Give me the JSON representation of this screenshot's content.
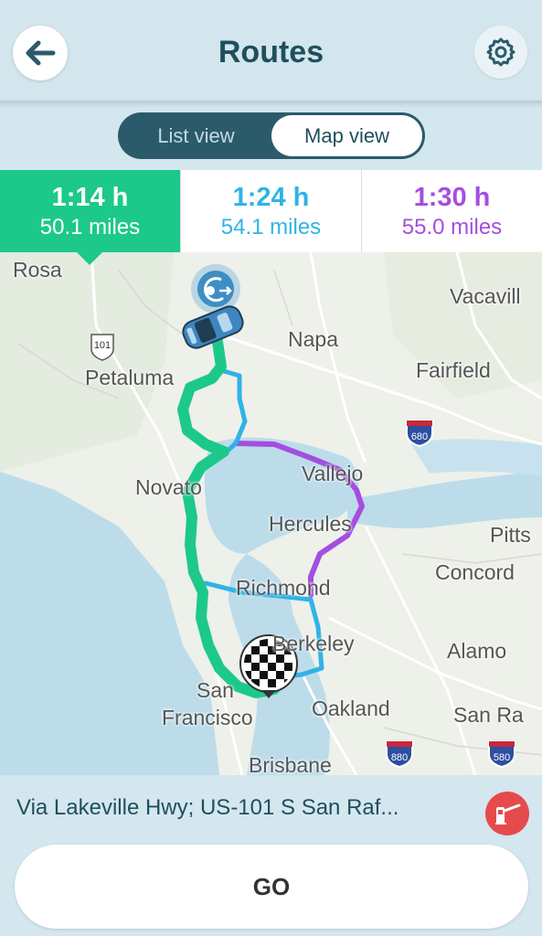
{
  "header": {
    "title": "Routes",
    "back_icon": "arrow-left-icon",
    "settings_icon": "gear-icon"
  },
  "view_toggle": {
    "list_label": "List view",
    "map_label": "Map view",
    "selected": "Map view"
  },
  "routes": [
    {
      "time": "1:14 h",
      "distance": "50.1 miles",
      "color": "#1cc98a",
      "selected": true
    },
    {
      "time": "1:24 h",
      "distance": "54.1 miles",
      "color": "#2fb3e6",
      "selected": false
    },
    {
      "time": "1:30 h",
      "distance": "55.0 miles",
      "color": "#a44ee0",
      "selected": false
    }
  ],
  "map": {
    "places": [
      "Rosa",
      "Vacavill",
      "Napa",
      "Petaluma",
      "Fairfield",
      "Novato",
      "Vallejo",
      "Hercules",
      "Pitts",
      "Concord",
      "Richmond",
      "Berkeley",
      "Alamo",
      "San",
      "Francisco",
      "Oakland",
      "San Ra",
      "Brisbane"
    ],
    "shields": [
      "101",
      "680",
      "880",
      "580"
    ]
  },
  "bottom": {
    "via": "Via Lakeville Hwy; US-101 S San Raf...",
    "toll_icon": "toll-gate-icon",
    "go_label": "GO"
  }
}
